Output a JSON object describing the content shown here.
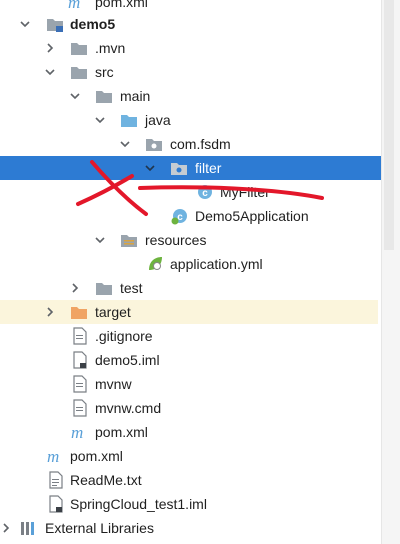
{
  "tree": {
    "items": [
      {
        "label": "pom.xml",
        "icon": "maven-m-icon"
      },
      {
        "label": "demo5",
        "icon": "module-folder-icon",
        "expanded": true
      },
      {
        "label": ".mvn",
        "icon": "folder-icon",
        "expanded": false
      },
      {
        "label": "src",
        "icon": "folder-icon",
        "expanded": true
      },
      {
        "label": "main",
        "icon": "folder-icon",
        "expanded": true
      },
      {
        "label": "java",
        "icon": "source-folder-icon",
        "expanded": true
      },
      {
        "label": "com.fsdm",
        "icon": "package-icon",
        "expanded": true
      },
      {
        "label": "filter",
        "icon": "package-icon",
        "expanded": true,
        "selected": true
      },
      {
        "label": "MyFilter",
        "icon": "class-icon"
      },
      {
        "label": "Demo5Application",
        "icon": "spring-class-icon"
      },
      {
        "label": "resources",
        "icon": "resources-folder-icon",
        "expanded": true
      },
      {
        "label": "application.yml",
        "icon": "spring-leaf-icon"
      },
      {
        "label": "test",
        "icon": "folder-icon",
        "expanded": false
      },
      {
        "label": "target",
        "icon": "excluded-folder-icon",
        "expanded": false
      },
      {
        "label": ".gitignore",
        "icon": "file-icon"
      },
      {
        "label": "demo5.iml",
        "icon": "file-icon"
      },
      {
        "label": "mvnw",
        "icon": "file-icon"
      },
      {
        "label": "mvnw.cmd",
        "icon": "file-icon"
      },
      {
        "label": "pom.xml",
        "icon": "maven-m-icon"
      },
      {
        "label": "pom.xml",
        "icon": "maven-m-icon"
      },
      {
        "label": "ReadMe.txt",
        "icon": "file-icon"
      },
      {
        "label": "SpringCloud_test1.iml",
        "icon": "file-icon"
      },
      {
        "label": "External Libraries",
        "icon": "libraries-icon",
        "expanded": false
      }
    ]
  },
  "colors": {
    "selection": "#2d7bd3",
    "folder": "#9aa4ad",
    "source_folder": "#6fb3e0",
    "excluded_folder": "#f0a464",
    "maven": "#5aa0d8",
    "annotation": "#e3172a"
  },
  "annotation": "red-handwritten-x-and-strike-through"
}
